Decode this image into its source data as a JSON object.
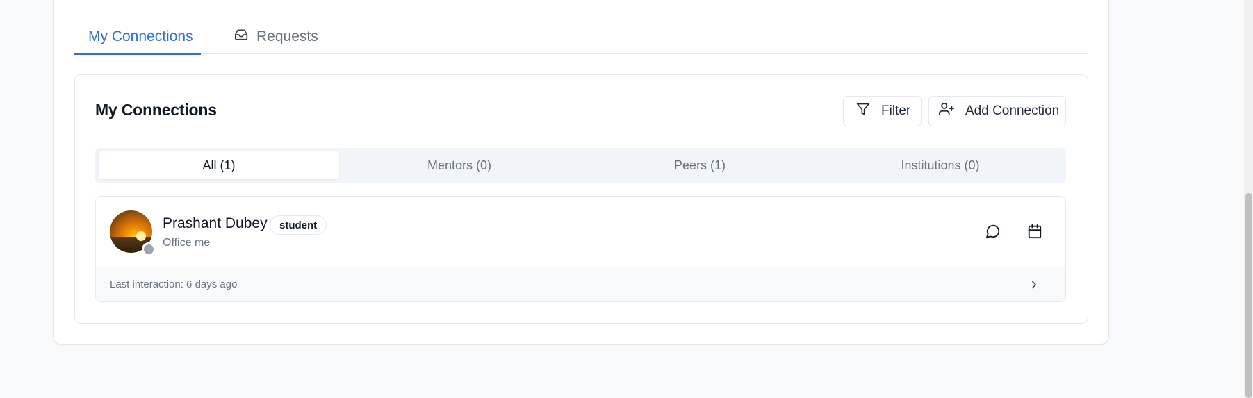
{
  "tabs": {
    "my_connections": "My Connections",
    "requests": "Requests"
  },
  "section": {
    "title": "My Connections",
    "filter_label": "Filter",
    "add_label": "Add Connection"
  },
  "segments": [
    {
      "label": "All (1)",
      "active": true
    },
    {
      "label": "Mentors (0)",
      "active": false
    },
    {
      "label": "Peers (1)",
      "active": false
    },
    {
      "label": "Institutions (0)",
      "active": false
    }
  ],
  "connections": [
    {
      "name": "Prashant Dubey",
      "role": "student",
      "subtitle": "Office me",
      "last_interaction": "Last interaction: 6 days ago"
    }
  ],
  "colors": {
    "accent": "#2f6fd6",
    "status_offline": "#9ca3af"
  },
  "icons": [
    "inbox-icon",
    "filter-icon",
    "user-plus-icon",
    "message-icon",
    "calendar-icon",
    "chevron-right-icon"
  ]
}
